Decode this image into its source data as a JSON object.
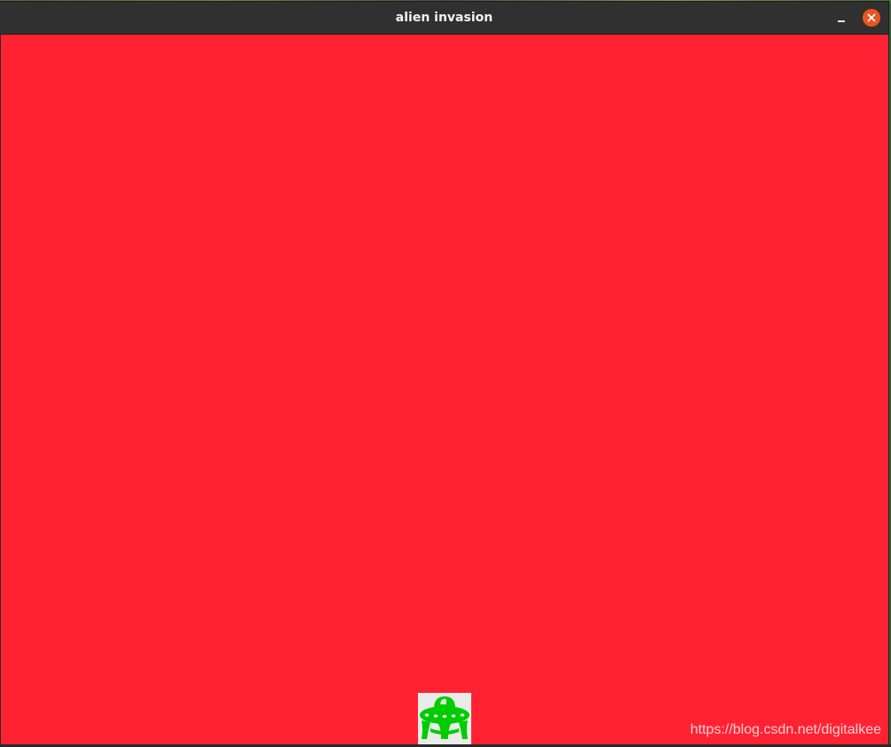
{
  "window": {
    "title": "alien invasion"
  },
  "game": {
    "background_color": "#ff2233",
    "ship": {
      "icon": "ufo-icon",
      "color": "#00cc00"
    }
  },
  "watermark": {
    "text": "https://blog.csdn.net/digitalkee"
  },
  "titlebar_buttons": {
    "minimize_icon": "minimize-icon",
    "close_icon": "close-icon",
    "close_color": "#e95420"
  }
}
